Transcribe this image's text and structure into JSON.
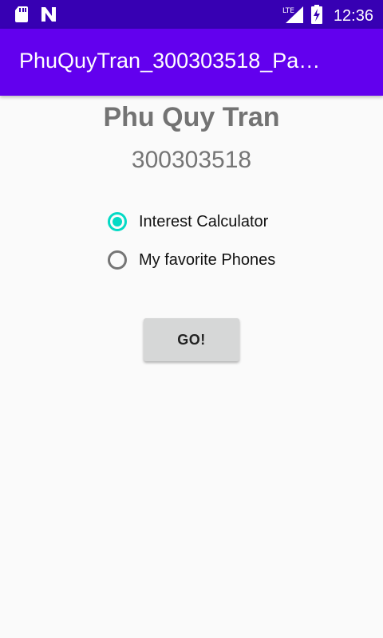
{
  "status_bar": {
    "time": "12:36",
    "network_label": "LTE",
    "left_icons": [
      "sd-card-icon",
      "n-notification-icon"
    ],
    "right_icons": [
      "lte-signal-icon",
      "battery-charging-icon"
    ]
  },
  "app_bar": {
    "title": "PhuQuyTran_300303518_Pa…",
    "color": "#6200ee"
  },
  "main": {
    "name": "Phu Quy Tran",
    "student_id": "300303518",
    "radio_options": [
      {
        "label": "Interest Calculator",
        "checked": true
      },
      {
        "label": "My favorite Phones",
        "checked": false
      }
    ],
    "go_button_label": "GO!"
  },
  "colors": {
    "accent": "#03dac5",
    "status_bar": "#3700b3",
    "background": "#fafafa"
  }
}
